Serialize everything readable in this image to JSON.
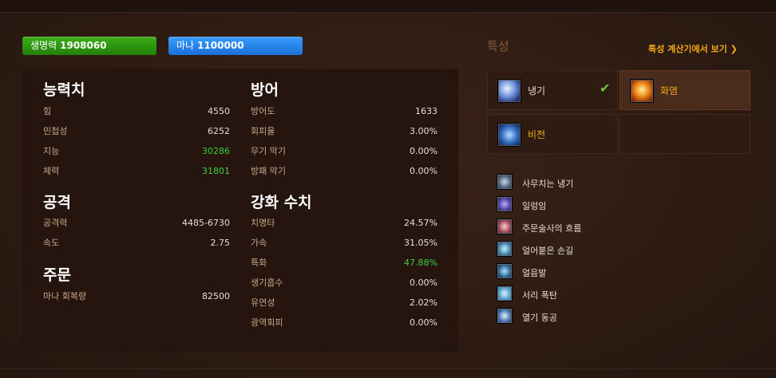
{
  "resources": {
    "health": {
      "label": "생명력",
      "value": "1908060"
    },
    "mana": {
      "label": "마나",
      "value": "1100000"
    }
  },
  "stats": {
    "abilities": {
      "title": "능력치",
      "rows": [
        {
          "label": "힘",
          "value": "4550"
        },
        {
          "label": "민첩성",
          "value": "6252"
        },
        {
          "label": "지능",
          "value": "30286",
          "highlight": true
        },
        {
          "label": "체력",
          "value": "31801",
          "highlight": true
        }
      ]
    },
    "attack": {
      "title": "공격",
      "rows": [
        {
          "label": "공격력",
          "value": "4485-6730"
        },
        {
          "label": "속도",
          "value": "2.75"
        }
      ]
    },
    "spell": {
      "title": "주문",
      "rows": [
        {
          "label": "마나 회복량",
          "value": "82500"
        }
      ]
    },
    "defense": {
      "title": "방어",
      "rows": [
        {
          "label": "방어도",
          "value": "1633"
        },
        {
          "label": "회피율",
          "value": "3.00%"
        },
        {
          "label": "무기 막기",
          "value": "0.00%"
        },
        {
          "label": "방패 막기",
          "value": "0.00%"
        }
      ]
    },
    "enhancement": {
      "title": "강화 수치",
      "rows": [
        {
          "label": "치명타",
          "value": "24.57%"
        },
        {
          "label": "가속",
          "value": "31.05%"
        },
        {
          "label": "특화",
          "value": "47.88%",
          "highlight": true
        },
        {
          "label": "생기흡수",
          "value": "0.00%"
        },
        {
          "label": "유연성",
          "value": "2.02%"
        },
        {
          "label": "광역회피",
          "value": "0.00%"
        }
      ]
    }
  },
  "talents": {
    "header": "특성",
    "calc_link": "특성 계산기에서 보기 ❯",
    "specs": [
      {
        "label": "냉기",
        "icon": "frost-icon",
        "active": false,
        "selected": true
      },
      {
        "label": "화염",
        "icon": "fire-icon",
        "active": true,
        "selected": false
      },
      {
        "label": "비전",
        "icon": "arcane-icon",
        "active": false,
        "selected": false
      }
    ],
    "list": [
      {
        "label": "사무치는 냉기",
        "icon": "skull-icon"
      },
      {
        "label": "일렁임",
        "icon": "shimmer-icon"
      },
      {
        "label": "주문술사의 흐름",
        "icon": "hand-icon"
      },
      {
        "label": "얼어붙은 손길",
        "icon": "frozen-touch-icon"
      },
      {
        "label": "얼음발",
        "icon": "ice-floes-icon"
      },
      {
        "label": "서리 폭탄",
        "icon": "frost-bomb-icon"
      },
      {
        "label": "열기 동공",
        "icon": "thermal-void-icon"
      }
    ]
  },
  "colors": {
    "health": "#2f9a12",
    "mana": "#2a8af0",
    "highlight": "#3bd03b",
    "link": "#f3a914"
  }
}
